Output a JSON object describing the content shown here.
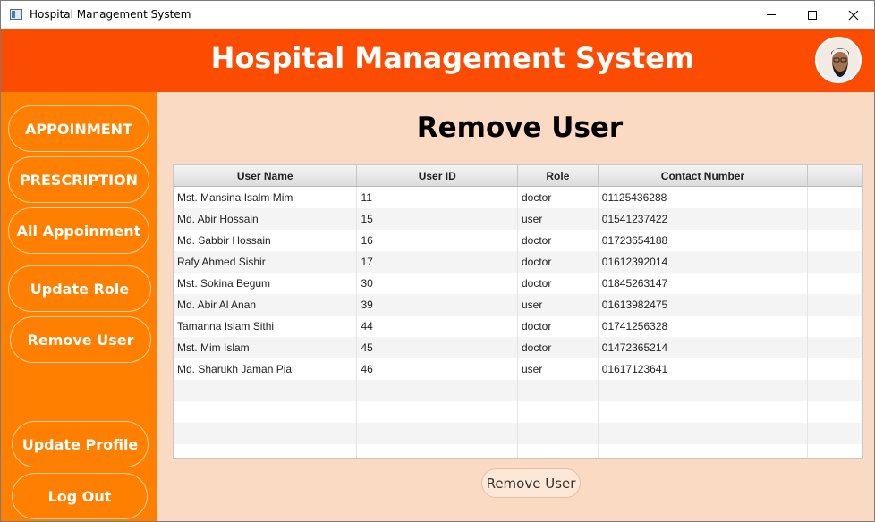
{
  "window": {
    "title": "Hospital Management System"
  },
  "header": {
    "title": "Hospital Management System"
  },
  "sidebar": {
    "items": [
      {
        "label": "APPOINMENT"
      },
      {
        "label": "PRESCRIPTION"
      },
      {
        "label": "All Appoinment"
      },
      {
        "label": "Update Role"
      },
      {
        "label": "Remove User"
      },
      {
        "label": "Update Profile"
      },
      {
        "label": "Log Out"
      }
    ]
  },
  "main": {
    "title": "Remove User",
    "table": {
      "columns": [
        "User Name",
        "User ID",
        "Role",
        "Contact Number",
        ""
      ],
      "rows": [
        [
          "Mst. Mansina Isalm Mim",
          "11",
          "doctor",
          "01125436288"
        ],
        [
          "Md. Abir Hossain",
          "15",
          "user",
          "01541237422"
        ],
        [
          "Md. Sabbir Hossain",
          "16",
          "doctor",
          "01723654188"
        ],
        [
          "Rafy Ahmed Sishir",
          "17",
          "doctor",
          "01612392014"
        ],
        [
          "Mst. Sokina Begum",
          "30",
          "doctor",
          "01845263147"
        ],
        [
          "Md. Abir Al Anan",
          "39",
          "user",
          "01613982475"
        ],
        [
          "Tamanna Islam Sithi",
          "44",
          "doctor",
          "01741256328"
        ],
        [
          "Mst. Mim Islam",
          "45",
          "doctor",
          "01472365214"
        ],
        [
          "Md. Sharukh Jaman Pial",
          "46",
          "user",
          "01617123641"
        ]
      ]
    },
    "action_label": "Remove User"
  },
  "colors": {
    "header": "#fc4c02",
    "sidebar": "#ff7f00",
    "main_bg": "#fadac3"
  }
}
